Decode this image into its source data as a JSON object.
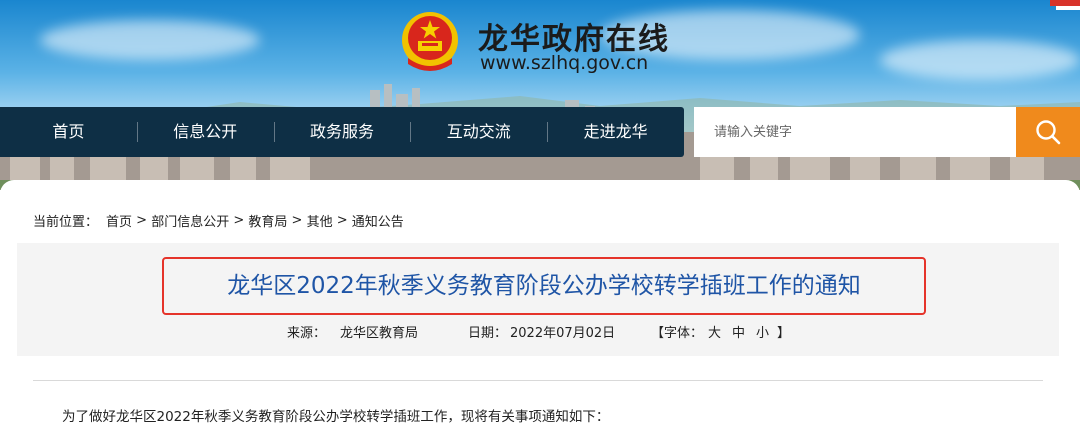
{
  "site": {
    "name": "龙华政府在线",
    "url": "www.szlhq.gov.cn"
  },
  "nav": {
    "items": [
      "首页",
      "信息公开",
      "政务服务",
      "互动交流",
      "走进龙华"
    ]
  },
  "search": {
    "placeholder": "请输入关键字",
    "icon": "search-icon"
  },
  "breadcrumb": {
    "label": "当前位置：",
    "items": [
      "首页",
      "部门信息公开",
      "教育局",
      "其他",
      "通知公告"
    ],
    "separator": " > "
  },
  "article": {
    "title": "龙华区2022年秋季义务教育阶段公办学校转学插班工作的通知",
    "source_label": "来源：",
    "source": "龙华区教育局",
    "date_label": "日期：",
    "date": "2022年07月02日",
    "font_open": "【字体：",
    "font_large": "大",
    "font_medium": "中",
    "font_small": "小",
    "font_close": "】",
    "intro": "为了做好龙华区2022年秋季义务教育阶段公办学校转学插班工作，现将有关事项通知如下："
  },
  "colors": {
    "nav_bg": "#0e2f45",
    "search_button": "#f08a1c",
    "title_text": "#1f55a6",
    "title_highlight": "#e5332a"
  }
}
